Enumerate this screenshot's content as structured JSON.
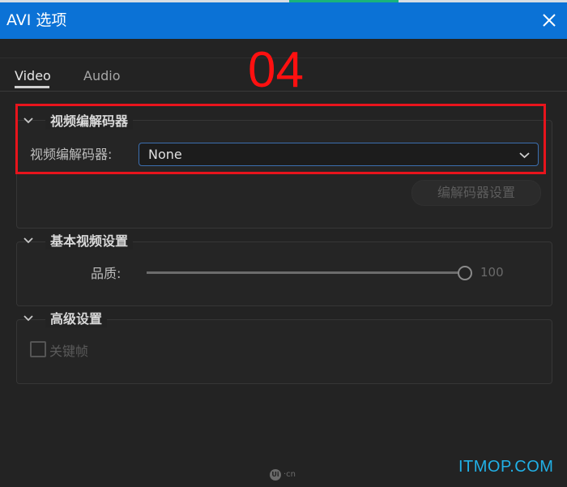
{
  "window": {
    "title": "AVI 选项"
  },
  "tabs": [
    {
      "label": "Video",
      "active": true
    },
    {
      "label": "Audio",
      "active": false
    }
  ],
  "annotation": {
    "number": "04",
    "color": "#e8141c"
  },
  "sections": {
    "codec": {
      "title": "视频编解码器",
      "field_label": "视频编解码器:",
      "selected_value": "None",
      "settings_button": "编解码器设置"
    },
    "basic_video": {
      "title": "基本视频设置",
      "quality_label": "品质:",
      "quality_value": "100"
    },
    "advanced": {
      "title": "高级设置",
      "keyframe_label": "关键帧",
      "keyframe_checked": false
    }
  },
  "watermarks": {
    "ui_logo": "Ui",
    "ui_suffix": "·cn",
    "site": "ITMOP.COM"
  },
  "colors": {
    "titlebar": "#0b72d6",
    "background": "#232323",
    "accent_border": "#3c6fb0"
  }
}
